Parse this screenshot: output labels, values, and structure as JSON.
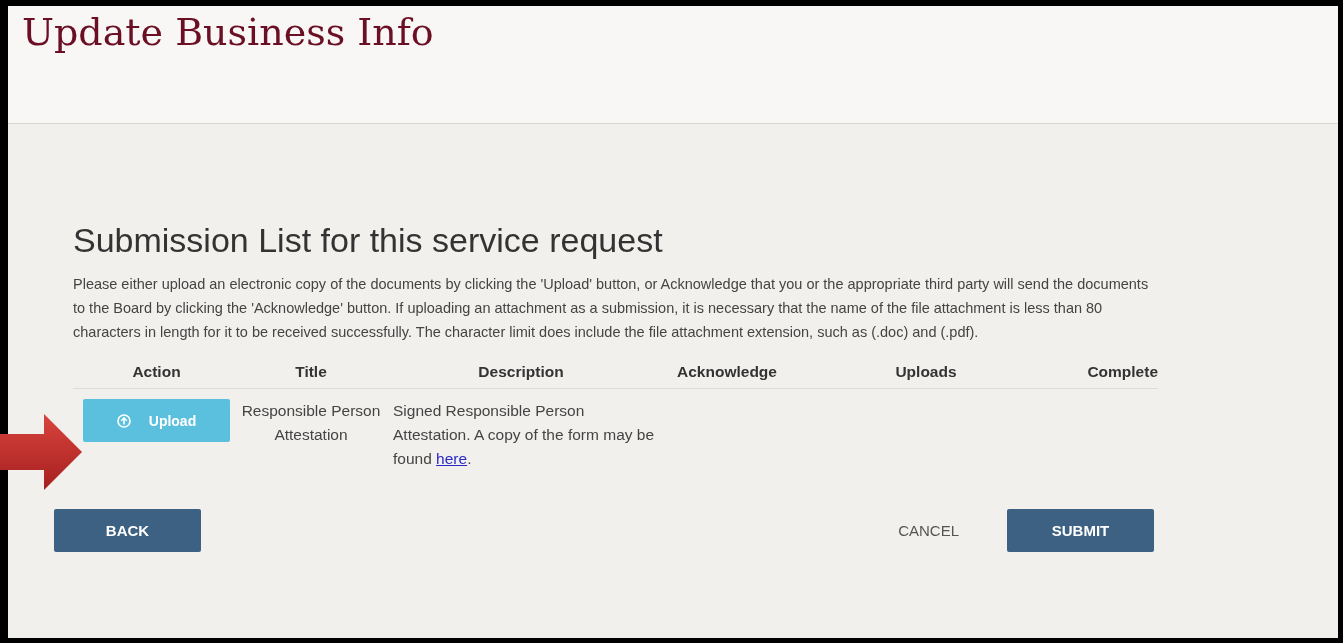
{
  "header": {
    "title": "Update Business Info"
  },
  "section": {
    "heading": "Submission List for this service request",
    "intro": "Please either upload an electronic copy of the documents by clicking the 'Upload' button, or Acknowledge that you or the appropriate third party will send the documents to the Board by clicking the 'Acknowledge' button. If uploading an attachment as a submission, it is necessary that the name of the file attachment is less than 80 characters in length for it to be received successfully. The character limit does include the file attachment extension, such as (.doc) and (.pdf)."
  },
  "table": {
    "columns": [
      "Action",
      "Title",
      "Description",
      "Acknowledge",
      "Uploads",
      "Complete"
    ],
    "rows": [
      {
        "action": "Upload",
        "title": "Responsible Person Attestation",
        "description": "Signed Responsible Person Attestation. A copy of the form may be found ",
        "link": "here",
        "description_end": "."
      }
    ]
  },
  "buttons": {
    "back": "BACK",
    "cancel": "CANCEL",
    "submit": "SUBMIT"
  }
}
